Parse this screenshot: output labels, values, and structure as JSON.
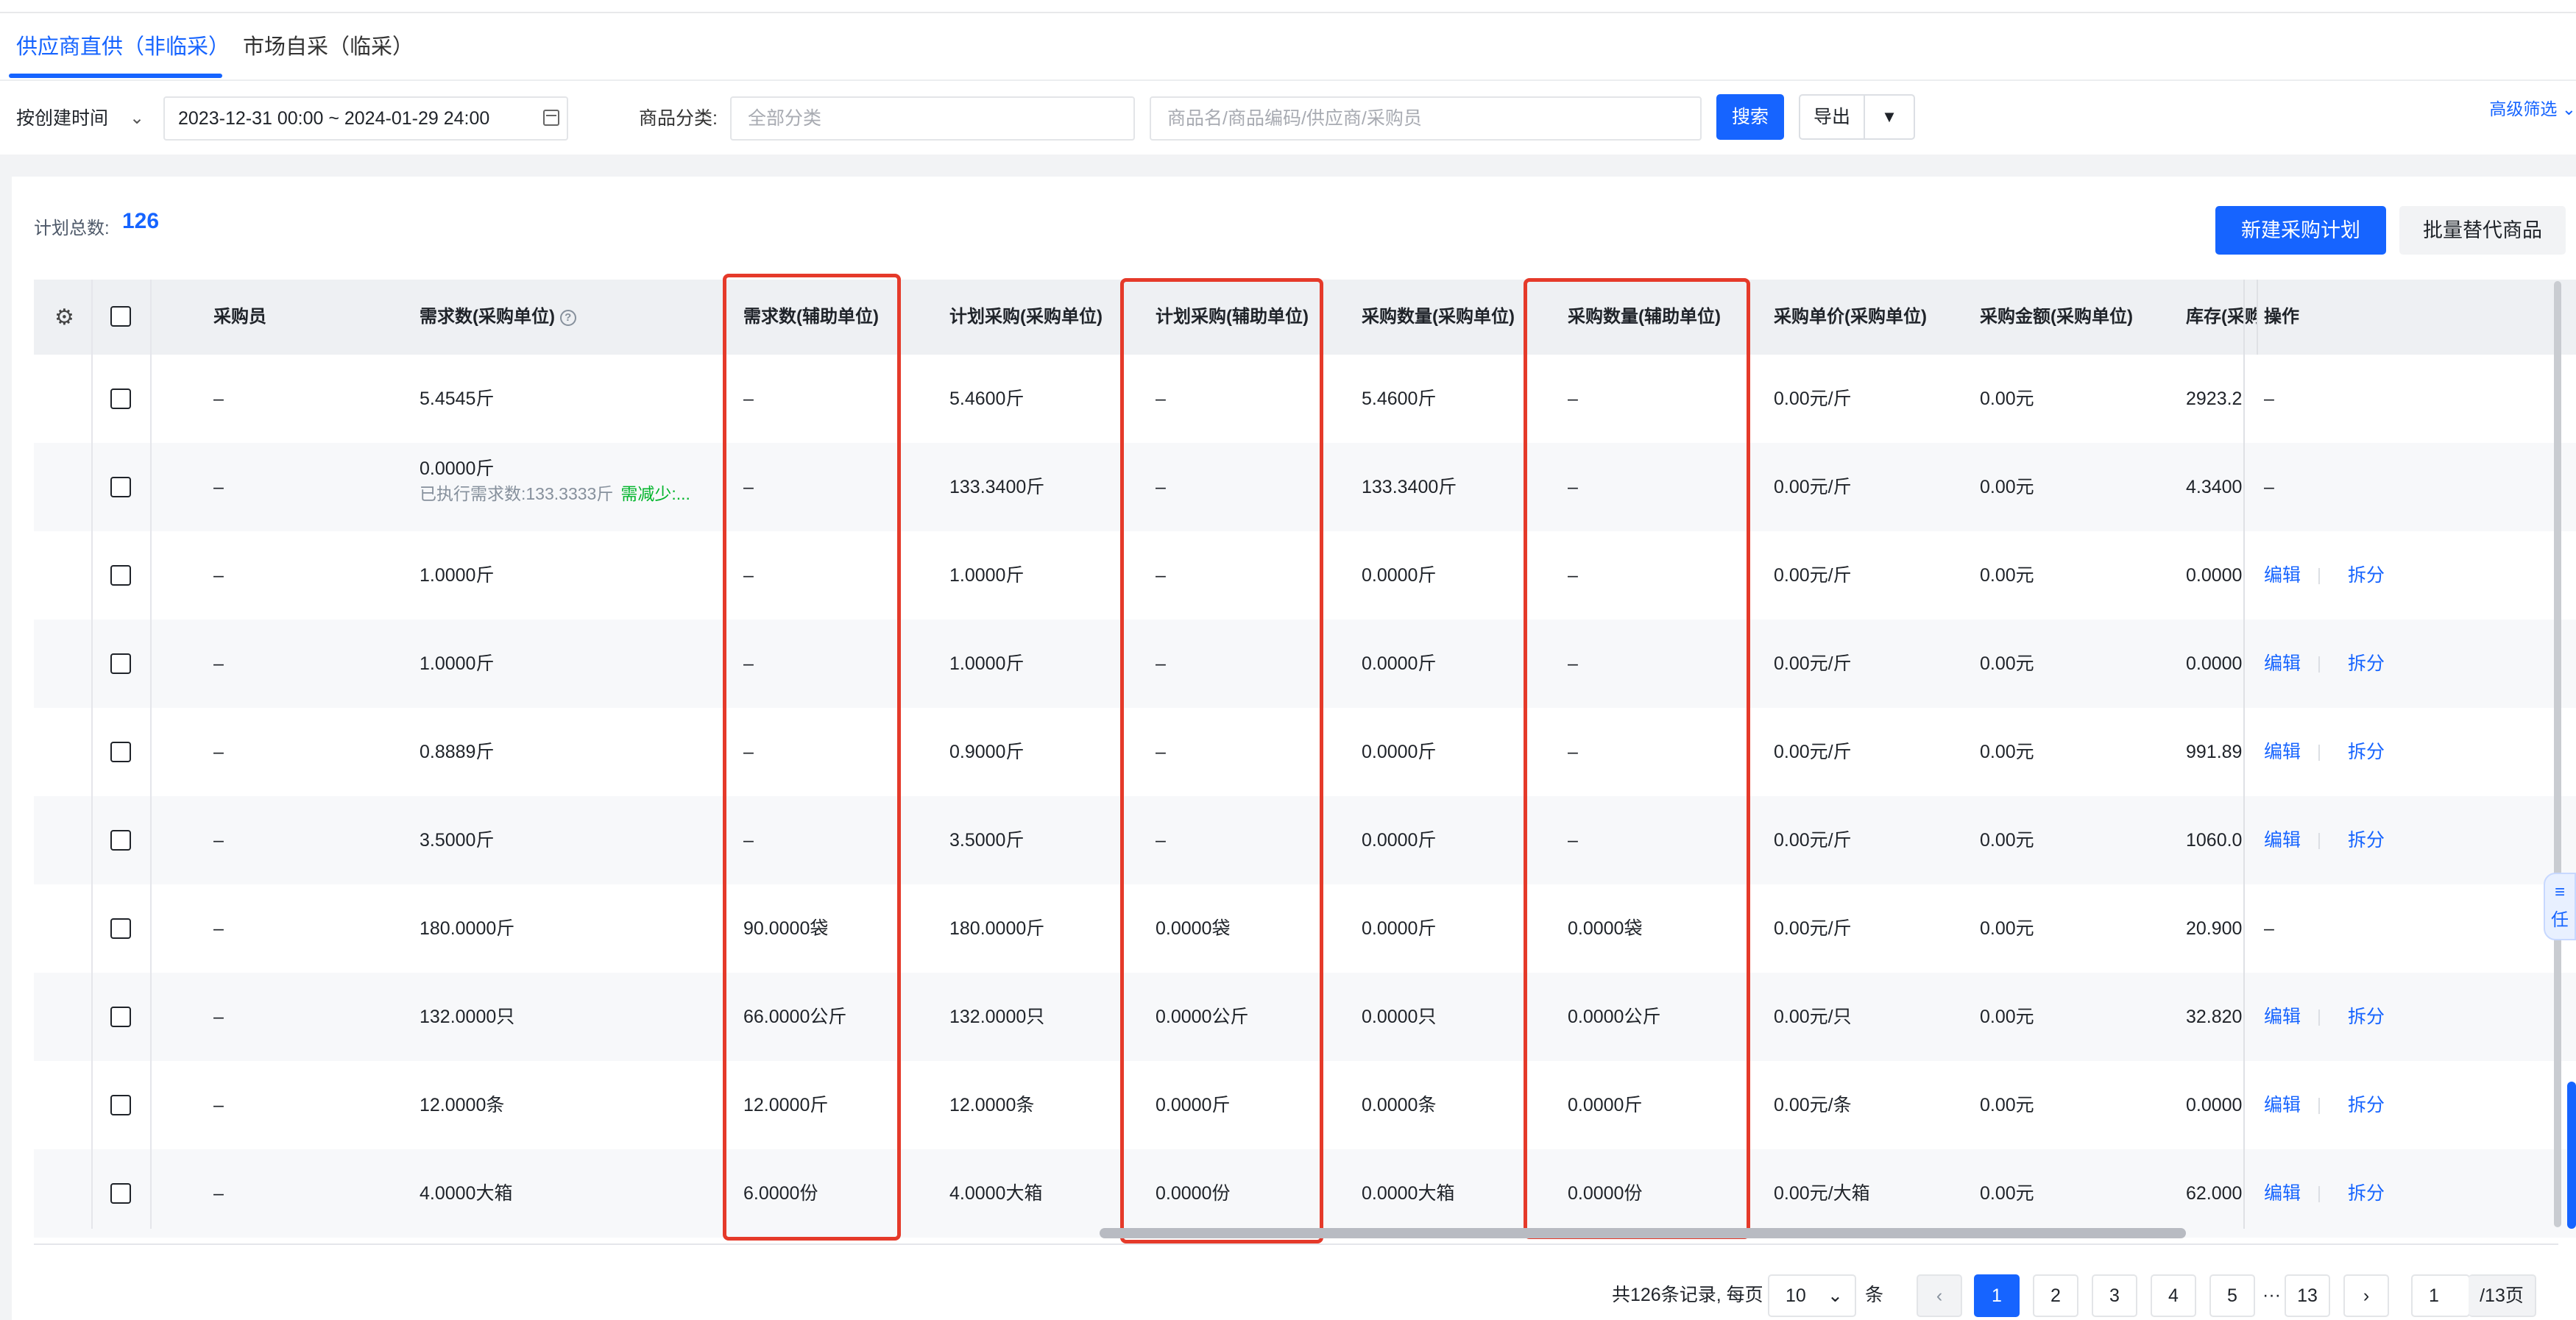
{
  "tabs": [
    {
      "label": "供应商直供（非临采）",
      "active": true
    },
    {
      "label": "市场自采（临采）",
      "active": false
    }
  ],
  "filters": {
    "time_type": "按创建时间",
    "date_range": "2023-12-31 00:00 ~ 2024-01-29 24:00",
    "category_label": "商品分类:",
    "category_placeholder": "全部分类",
    "search_placeholder": "商品名/商品编码/供应商/采购员",
    "search_button": "搜索",
    "export_button": "导出",
    "advanced_filter": "高级筛选"
  },
  "summary": {
    "total_label": "计划总数:",
    "total_value": "126"
  },
  "actions": {
    "create_plan": "新建采购计划",
    "batch_replace": "批量替代商品"
  },
  "table": {
    "columns": {
      "buyer": "采购员",
      "demand_unit": "需求数(采购单位)",
      "demand_aux": "需求数(辅助单位)",
      "plan_unit": "计划采购(采购单位)",
      "plan_aux": "计划采购(辅助单位)",
      "qty_unit": "采购数量(采购单位)",
      "qty_aux": "采购数量(辅助单位)",
      "price": "采购单价(采购单位)",
      "amount": "采购金额(采购单位)",
      "stock": "库存(采购单位)",
      "ops": "操作"
    },
    "rows": [
      {
        "buyer": "–",
        "demand": "5.4545斤",
        "demand_sub": "",
        "demand_sub2": "",
        "demand_aux": "–",
        "plan": "5.4600斤",
        "plan_aux": "–",
        "qty": "5.4600斤",
        "qty_aux": "–",
        "price": "0.00元/斤",
        "amount": "0.00元",
        "stock": "2923.2",
        "ops": false,
        "ops_text": "–"
      },
      {
        "buyer": "–",
        "demand": "0.0000斤",
        "demand_sub": "已执行需求数:133.3333斤",
        "demand_sub2": "需减少:...",
        "demand_aux": "–",
        "plan": "133.3400斤",
        "plan_aux": "–",
        "qty": "133.3400斤",
        "qty_aux": "–",
        "price": "0.00元/斤",
        "amount": "0.00元",
        "stock": "4.3400",
        "ops": false,
        "ops_text": "–"
      },
      {
        "buyer": "–",
        "demand": "1.0000斤",
        "demand_sub": "",
        "demand_sub2": "",
        "demand_aux": "–",
        "plan": "1.0000斤",
        "plan_aux": "–",
        "qty": "0.0000斤",
        "qty_aux": "–",
        "price": "0.00元/斤",
        "amount": "0.00元",
        "stock": "0.0000",
        "ops": true,
        "ops_text": ""
      },
      {
        "buyer": "–",
        "demand": "1.0000斤",
        "demand_sub": "",
        "demand_sub2": "",
        "demand_aux": "–",
        "plan": "1.0000斤",
        "plan_aux": "–",
        "qty": "0.0000斤",
        "qty_aux": "–",
        "price": "0.00元/斤",
        "amount": "0.00元",
        "stock": "0.0000",
        "ops": true,
        "ops_text": ""
      },
      {
        "buyer": "–",
        "demand": "0.8889斤",
        "demand_sub": "",
        "demand_sub2": "",
        "demand_aux": "–",
        "plan": "0.9000斤",
        "plan_aux": "–",
        "qty": "0.0000斤",
        "qty_aux": "–",
        "price": "0.00元/斤",
        "amount": "0.00元",
        "stock": "991.89",
        "ops": true,
        "ops_text": ""
      },
      {
        "buyer": "–",
        "demand": "3.5000斤",
        "demand_sub": "",
        "demand_sub2": "",
        "demand_aux": "–",
        "plan": "3.5000斤",
        "plan_aux": "–",
        "qty": "0.0000斤",
        "qty_aux": "–",
        "price": "0.00元/斤",
        "amount": "0.00元",
        "stock": "1060.0",
        "ops": true,
        "ops_text": ""
      },
      {
        "buyer": "–",
        "demand": "180.0000斤",
        "demand_sub": "",
        "demand_sub2": "",
        "demand_aux": "90.0000袋",
        "plan": "180.0000斤",
        "plan_aux": "0.0000袋",
        "qty": "0.0000斤",
        "qty_aux": "0.0000袋",
        "price": "0.00元/斤",
        "amount": "0.00元",
        "stock": "20.900",
        "ops": false,
        "ops_text": "–"
      },
      {
        "buyer": "–",
        "demand": "132.0000只",
        "demand_sub": "",
        "demand_sub2": "",
        "demand_aux": "66.0000公斤",
        "plan": "132.0000只",
        "plan_aux": "0.0000公斤",
        "qty": "0.0000只",
        "qty_aux": "0.0000公斤",
        "price": "0.00元/只",
        "amount": "0.00元",
        "stock": "32.820",
        "ops": true,
        "ops_text": ""
      },
      {
        "buyer": "–",
        "demand": "12.0000条",
        "demand_sub": "",
        "demand_sub2": "",
        "demand_aux": "12.0000斤",
        "plan": "12.0000条",
        "plan_aux": "0.0000斤",
        "qty": "0.0000条",
        "qty_aux": "0.0000斤",
        "price": "0.00元/条",
        "amount": "0.00元",
        "stock": "0.0000",
        "ops": true,
        "ops_text": ""
      },
      {
        "buyer": "–",
        "demand": "4.0000大箱",
        "demand_sub": "",
        "demand_sub2": "",
        "demand_aux": "6.0000份",
        "plan": "4.0000大箱",
        "plan_aux": "0.0000份",
        "qty": "0.0000大箱",
        "qty_aux": "0.0000份",
        "price": "0.00元/大箱",
        "amount": "0.00元",
        "stock": "62.000",
        "ops": true,
        "ops_text": ""
      }
    ],
    "op_edit": "编辑",
    "op_split": "拆分"
  },
  "pagination": {
    "summary": "共126条记录, 每页",
    "page_size": "10",
    "unit": "条",
    "pages": [
      "1",
      "2",
      "3",
      "4",
      "5"
    ],
    "ellipsis": "···",
    "last_page": "13",
    "current_input": "1",
    "total_pages": "/13页"
  },
  "side_widget": {
    "label": "任"
  },
  "colors": {
    "primary": "#1664ff",
    "highlight_box": "#e53a2a",
    "hint_green": "#00b42a"
  }
}
